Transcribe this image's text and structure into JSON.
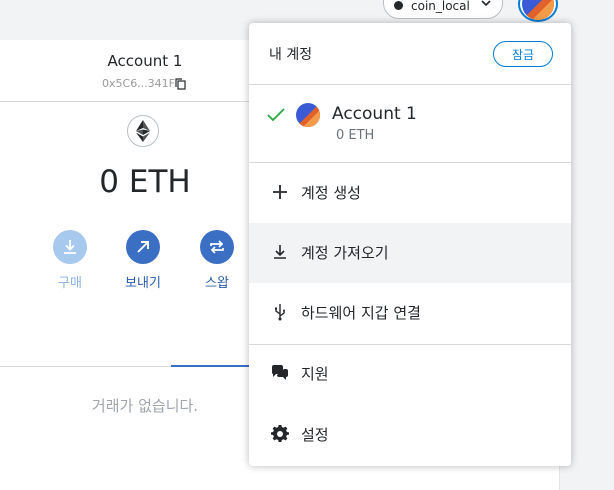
{
  "network": {
    "label": "coin_local"
  },
  "account": {
    "name": "Account 1",
    "address": "0x5C6...341F",
    "balance": "0 ETH"
  },
  "actions": [
    {
      "label": "구매",
      "icon": "download-icon"
    },
    {
      "label": "보내기",
      "icon": "arrow-up-right-icon"
    },
    {
      "label": "스왑",
      "icon": "swap-icon"
    }
  ],
  "activity": {
    "empty_text": "거래가 없습니다."
  },
  "menu": {
    "title": "내 계정",
    "lock_label": "잠금",
    "selected_account": {
      "name": "Account 1",
      "balance": "0 ETH"
    },
    "items": [
      {
        "label": "계정 생성",
        "icon": "plus-icon"
      },
      {
        "label": "계정 가져오기",
        "icon": "import-icon"
      },
      {
        "label": "하드웨어 지갑 연결",
        "icon": "usb-icon"
      },
      {
        "label": "지원",
        "icon": "chat-icon"
      },
      {
        "label": "설정",
        "icon": "gear-icon"
      }
    ]
  },
  "colors": {
    "accent": "#037dd6",
    "action_button": "#3a6fc4",
    "check": "#28a745"
  }
}
